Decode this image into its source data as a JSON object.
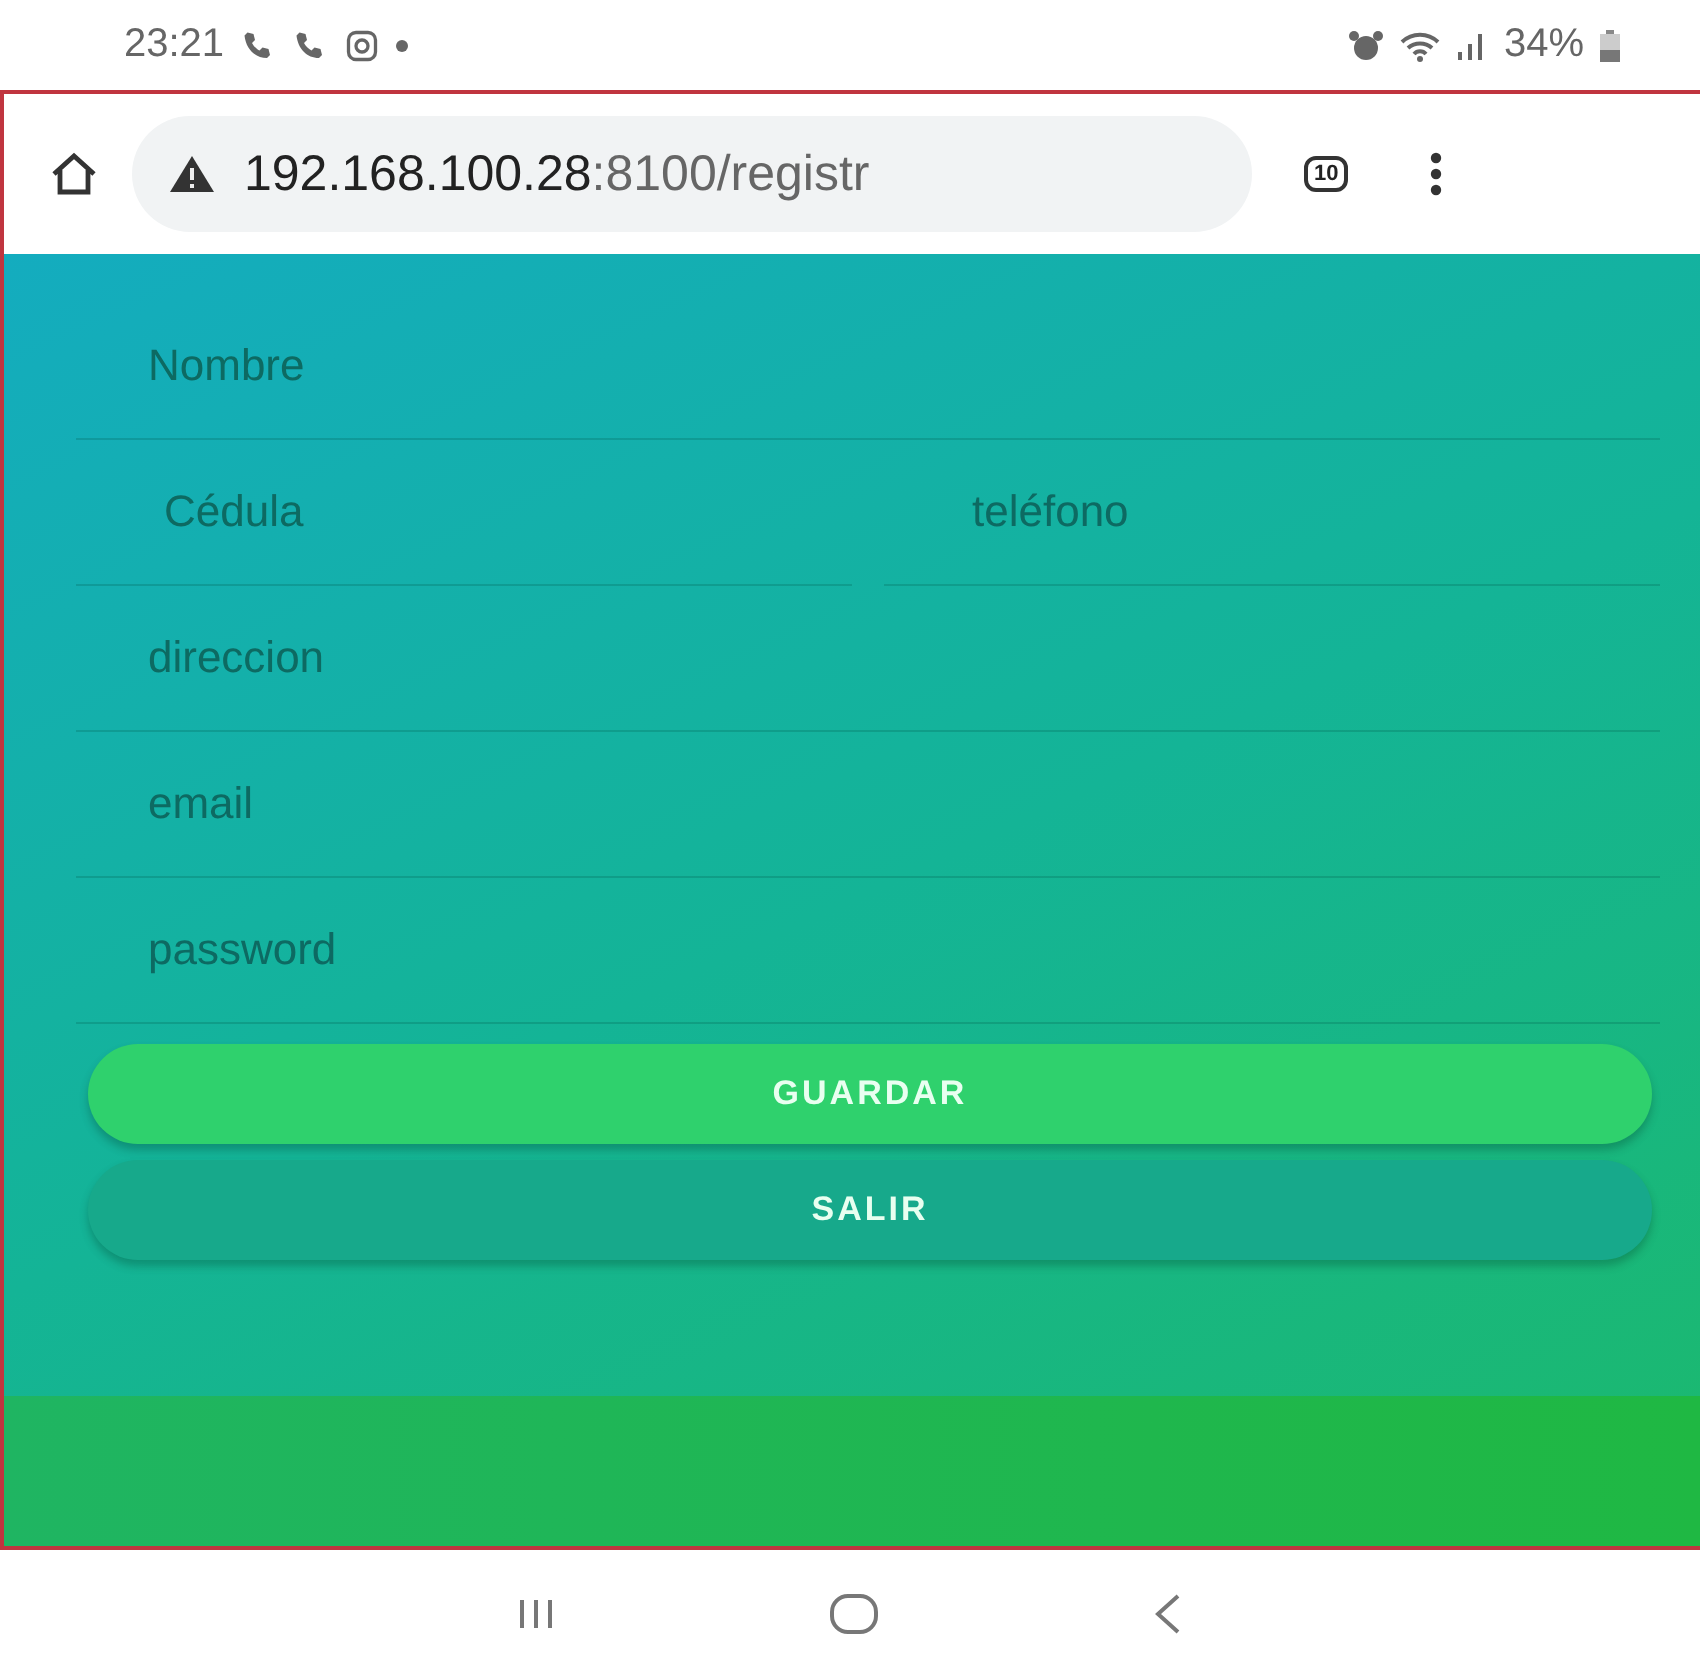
{
  "status_bar": {
    "time": "23:21",
    "battery": "34%"
  },
  "browser": {
    "url_host": "192.168.100.28",
    "url_rest": ":8100/registr",
    "tab_count": "10"
  },
  "form": {
    "rows": [
      [
        {
          "placeholder": "Nombre"
        }
      ],
      [
        {
          "placeholder": "Cédula"
        },
        {
          "placeholder": "teléfono"
        }
      ],
      [
        {
          "placeholder": "direccion"
        }
      ],
      [
        {
          "placeholder": "email"
        }
      ],
      [
        {
          "placeholder": "password"
        }
      ]
    ]
  },
  "buttons": [
    {
      "label": "GUARDAR",
      "kind": "primary"
    },
    {
      "label": "SALIR",
      "kind": "secondary"
    }
  ]
}
